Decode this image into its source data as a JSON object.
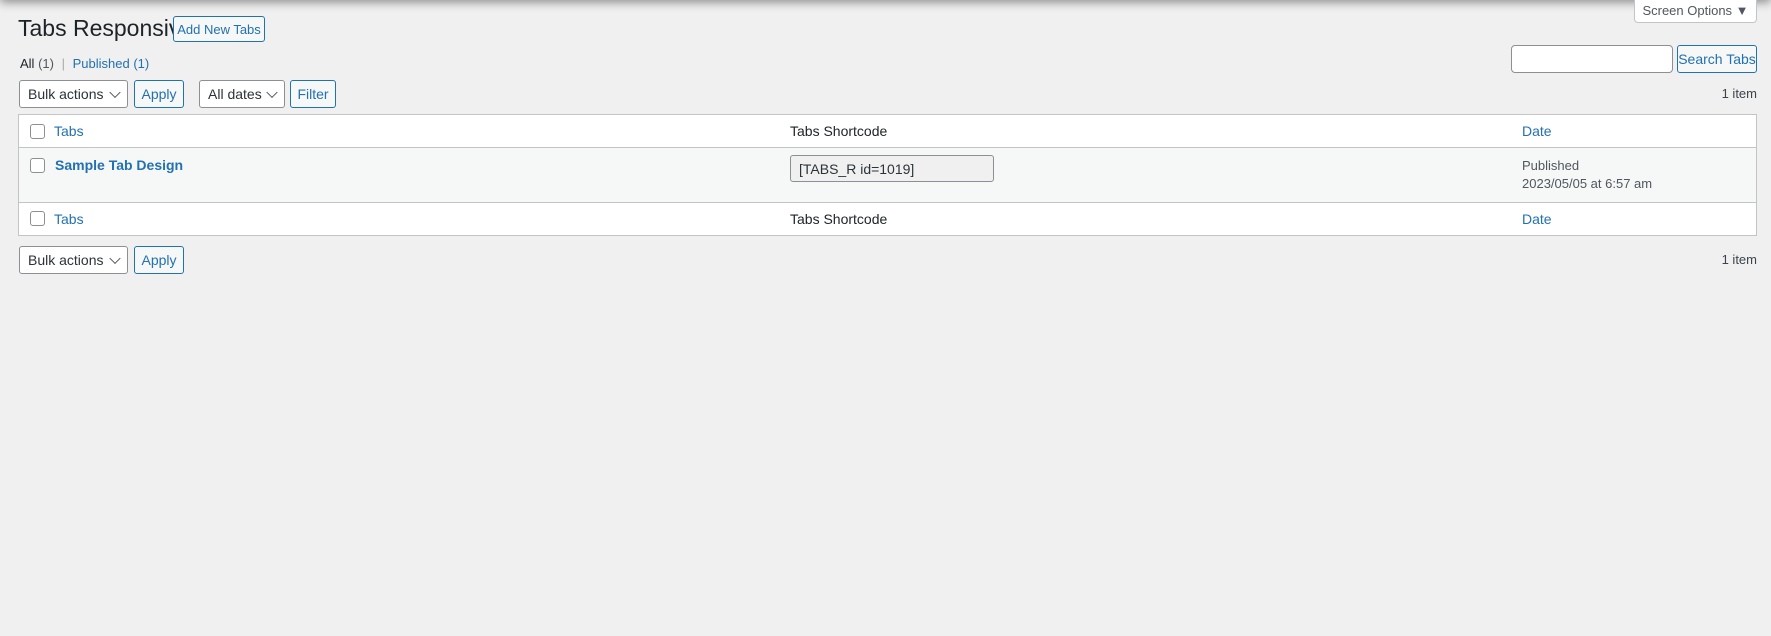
{
  "header": {
    "title": "Tabs Responsive",
    "add_new": "Add New Tabs",
    "screen_options": "Screen Options ▼"
  },
  "filters": {
    "all": "All",
    "all_count": "(1)",
    "sep": "|",
    "published": "Published",
    "published_count": "(1)"
  },
  "search": {
    "value": "",
    "button": "Search Tabs"
  },
  "top_nav": {
    "bulk": "Bulk actions",
    "apply": "Apply",
    "dates": "All dates",
    "filter": "Filter",
    "count": "1 item"
  },
  "columns": {
    "title": "Tabs",
    "shortcode": "Tabs Shortcode",
    "date": "Date"
  },
  "rows": [
    {
      "title": "Sample Tab Design",
      "shortcode": "[TABS_R id=1019]",
      "status": "Published",
      "date": "2023/05/05 at 6:57 am"
    }
  ],
  "bottom_nav": {
    "bulk": "Bulk actions",
    "apply": "Apply",
    "count": "1 item"
  }
}
